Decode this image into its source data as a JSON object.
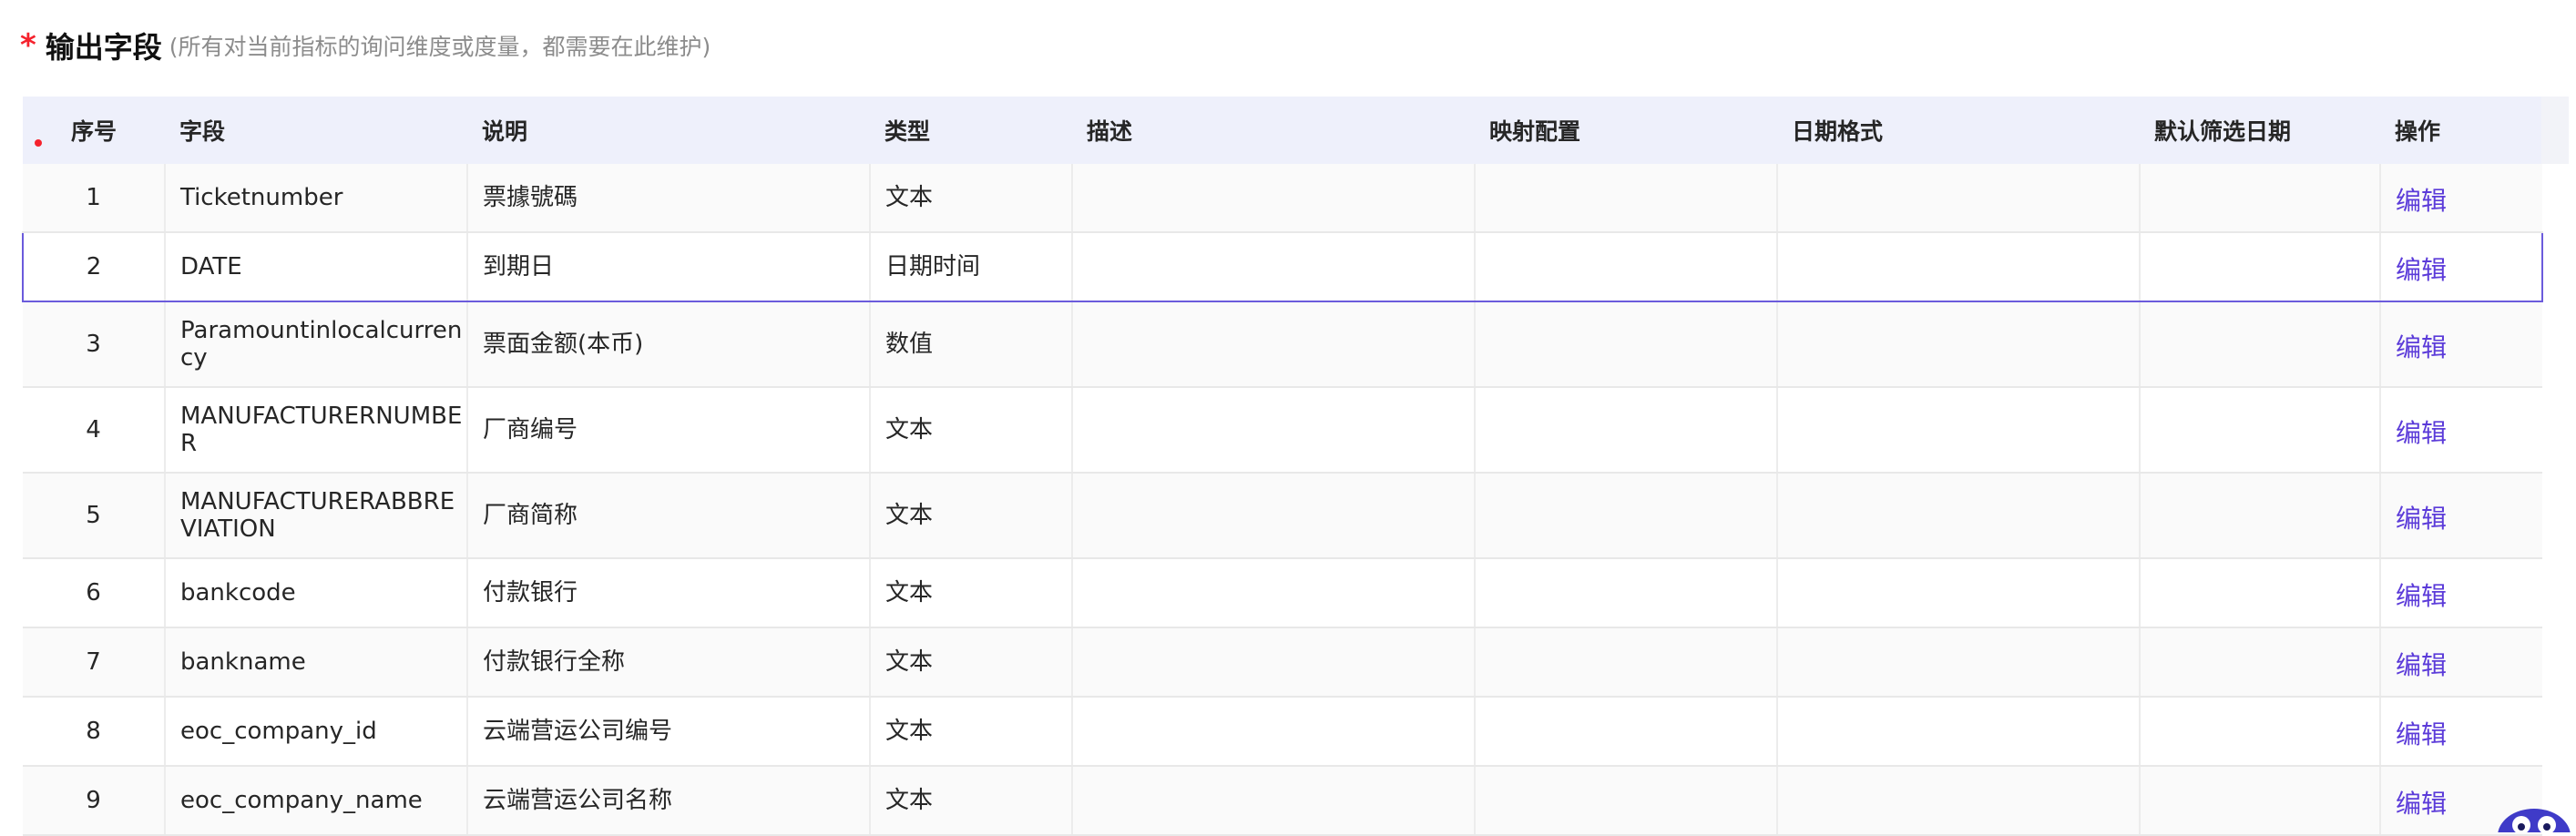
{
  "section": {
    "required_mark": "*",
    "title": "输出字段",
    "hint": "(所有对当前指标的询问维度或度量，都需要在此维护)"
  },
  "table": {
    "headers": {
      "seq": "序号",
      "field": "字段",
      "label": "说明",
      "type": "类型",
      "desc": "描述",
      "mapping": "映射配置",
      "date_format": "日期格式",
      "default_date": "默认筛选日期",
      "action": "操作"
    },
    "selected_row": 1,
    "rows": [
      {
        "seq": "1",
        "field": "Ticketnumber",
        "label": "票據號碼",
        "type": "文本",
        "desc": "",
        "mapping": "",
        "date_format": "",
        "default_date": "",
        "action": "编辑"
      },
      {
        "seq": "2",
        "field": "DATE",
        "label": "到期日",
        "type": "日期时间",
        "desc": "",
        "mapping": "",
        "date_format": "",
        "default_date": "",
        "action": "编辑"
      },
      {
        "seq": "3",
        "field": "Paramountinlocalcurrency",
        "label": "票面金额(本币)",
        "type": "数值",
        "desc": "",
        "mapping": "",
        "date_format": "",
        "default_date": "",
        "action": "编辑"
      },
      {
        "seq": "4",
        "field": "MANUFACTURERNUMBER",
        "label": "厂商编号",
        "type": "文本",
        "desc": "",
        "mapping": "",
        "date_format": "",
        "default_date": "",
        "action": "编辑"
      },
      {
        "seq": "5",
        "field": "MANUFACTURERABBREVIATION",
        "label": "厂商简称",
        "type": "文本",
        "desc": "",
        "mapping": "",
        "date_format": "",
        "default_date": "",
        "action": "编辑"
      },
      {
        "seq": "6",
        "field": "bankcode",
        "label": "付款银行",
        "type": "文本",
        "desc": "",
        "mapping": "",
        "date_format": "",
        "default_date": "",
        "action": "编辑"
      },
      {
        "seq": "7",
        "field": "bankname",
        "label": "付款银行全称",
        "type": "文本",
        "desc": "",
        "mapping": "",
        "date_format": "",
        "default_date": "",
        "action": "编辑"
      },
      {
        "seq": "8",
        "field": "eoc_company_id",
        "label": "云端营运公司编号",
        "type": "文本",
        "desc": "",
        "mapping": "",
        "date_format": "",
        "default_date": "",
        "action": "编辑"
      },
      {
        "seq": "9",
        "field": "eoc_company_name",
        "label": "云端营运公司名称",
        "type": "文本",
        "desc": "",
        "mapping": "",
        "date_format": "",
        "default_date": "",
        "action": "编辑"
      }
    ]
  },
  "colors": {
    "accent": "#5b3bd9",
    "selected_border": "#6b5bdc",
    "required": "#f5222d",
    "header_bg": "#eef0fb"
  },
  "icons": {
    "mascot": "owl-mascot-icon"
  }
}
